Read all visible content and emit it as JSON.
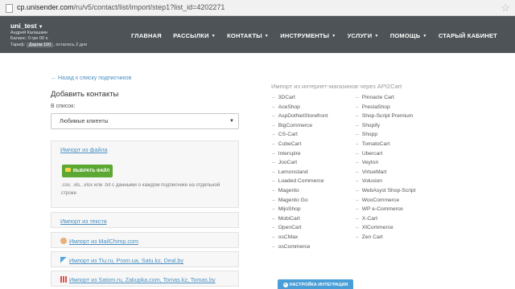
{
  "browser": {
    "url_host": "cp.unisender.com",
    "url_path": "/ru/v5/contact/list/import/step1?list_id=4202271"
  },
  "account": {
    "username": "uni_test",
    "fullname": "Андрей Калашкин",
    "balance": "Баланс: 0 грн 00 к.",
    "tariff_label": "Тариф:",
    "tariff_plan": "Даром 100",
    "tariff_rest": ", осталось 2 дня"
  },
  "nav": {
    "items": [
      {
        "label": "ГЛАВНАЯ",
        "dropdown": false
      },
      {
        "label": "РАССЫЛКИ",
        "dropdown": true
      },
      {
        "label": "КОНТАКТЫ",
        "dropdown": true
      },
      {
        "label": "ИНСТРУМЕНТЫ",
        "dropdown": true
      },
      {
        "label": "УСЛУГИ",
        "dropdown": true
      },
      {
        "label": "ПОМОЩЬ",
        "dropdown": true
      },
      {
        "label": "СТАРЫЙ КАБИНЕТ",
        "dropdown": false
      }
    ]
  },
  "main": {
    "back_link": "← Назад к списку подписчиков",
    "title": "Добавить контакты",
    "list_label": "В список:",
    "list_value": "Любимые клиенты",
    "file_panel": {
      "title": "Импорт из файла",
      "button": "ВЫБРАТЬ ФАЙЛ",
      "hint": ".csv, .xls, .xlsx или .txt с данными о каждом подписчике на отдельной строке"
    },
    "text_panel": {
      "title": "Импорт из текста"
    },
    "mailchimp_panel": {
      "title": "Импорт из MailChimp.com"
    },
    "tiu_panel": {
      "title": "Импорт из Tiu.ru, Prom.ua, Satu.kz, Deal.by"
    },
    "satom_panel": {
      "title": "Импорт из Satom.ru, Zakupka.com, Tomas.kz, Tomas.by"
    }
  },
  "carts": {
    "title": "Импорт из интернет-магазинов через API2Cart",
    "column1": [
      "3DCart",
      "AceShop",
      "AspDotNetStorefront",
      "BigCommerce",
      "CS-Cart",
      "CubeCart",
      "Interspire",
      "JooCart",
      "Lemonstand",
      "Loaded Commerce",
      "Magento",
      "Magento Go",
      "MijoShop",
      "MobiCart",
      "OpenCart",
      "osCMax",
      "osCommerce"
    ],
    "column2": [
      "Pinnacle Cart",
      "PrestaShop",
      "Shop-Script Premium",
      "Shopify",
      "Shopp",
      "TomatoCart",
      "Ubercart",
      "Veyton",
      "VirtueMart",
      "Volusion",
      "WebAsyst Shop-Script",
      "WooCommerce",
      "WP e-Commerce",
      "X-Cart",
      "XtCommerce",
      "Zen Cart"
    ],
    "setup_button": "НАСТРОЙКА ИНТЕГРАЦИИ"
  },
  "colors": {
    "nav_bg": "#4d5357",
    "link": "#4a90c2",
    "green_button": "#5ba832",
    "blue_button": "#4a9ed8"
  }
}
